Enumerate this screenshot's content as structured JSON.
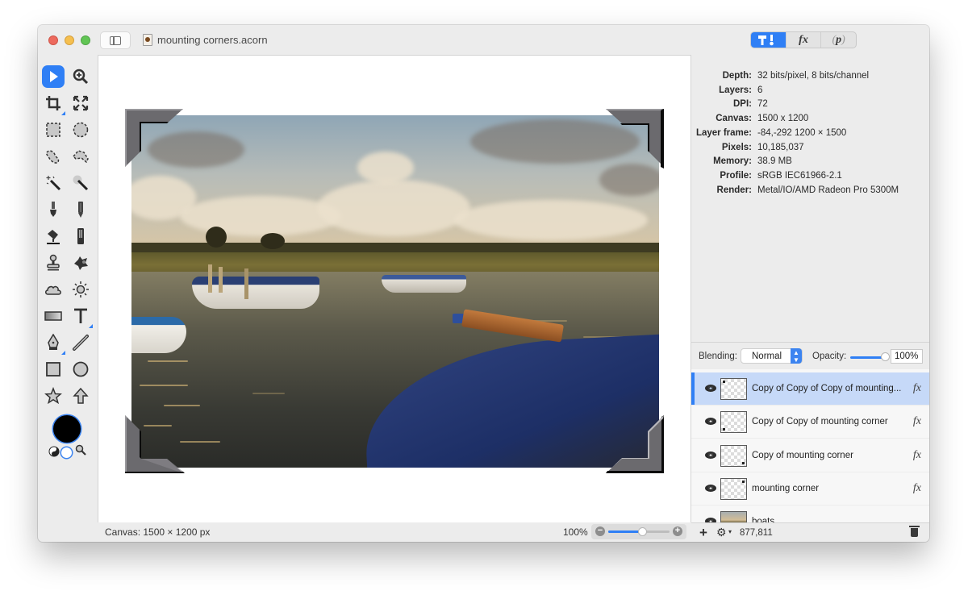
{
  "window": {
    "title": "mounting corners.acorn"
  },
  "inspector_tabs": [
    {
      "name": "tools",
      "icon": "hammer-brush-icon",
      "label": "T!",
      "active": true
    },
    {
      "name": "filters",
      "icon": "fx-icon",
      "label": "fx",
      "active": false
    },
    {
      "name": "plugins",
      "icon": "p-icon",
      "label": "p",
      "active": false
    }
  ],
  "toolbox": {
    "tools": [
      {
        "name": "select-tool",
        "active": true
      },
      {
        "name": "zoom-tool"
      },
      {
        "name": "crop-tool"
      },
      {
        "name": "transform-tool"
      },
      {
        "name": "rect-marquee-tool"
      },
      {
        "name": "ellipse-marquee-tool"
      },
      {
        "name": "lasso-tool"
      },
      {
        "name": "polygon-lasso-tool"
      },
      {
        "name": "magic-wand-tool"
      },
      {
        "name": "instant-alpha-tool"
      },
      {
        "name": "brush-tool"
      },
      {
        "name": "pencil-tool"
      },
      {
        "name": "paint-bucket-tool"
      },
      {
        "name": "eraser-tool"
      },
      {
        "name": "clone-stamp-tool"
      },
      {
        "name": "smudge-tool"
      },
      {
        "name": "cloud-tool"
      },
      {
        "name": "sun-tool"
      },
      {
        "name": "gradient-tool"
      },
      {
        "name": "text-tool"
      },
      {
        "name": "pen-tool"
      },
      {
        "name": "line-tool"
      },
      {
        "name": "rectangle-shape-tool"
      },
      {
        "name": "oval-shape-tool"
      },
      {
        "name": "star-shape-tool"
      },
      {
        "name": "arrow-shape-tool"
      }
    ],
    "foreground_color": "#000000"
  },
  "info": [
    {
      "label": "Depth:",
      "value": "32 bits/pixel, 8 bits/channel"
    },
    {
      "label": "Layers:",
      "value": "6"
    },
    {
      "label": "DPI:",
      "value": "72"
    },
    {
      "label": "Canvas:",
      "value": "1500 x 1200"
    },
    {
      "label": "Layer frame:",
      "value": "-84,-292 1200 × 1500"
    },
    {
      "label": "Pixels:",
      "value": "10,185,037"
    },
    {
      "label": "Memory:",
      "value": "38.9 MB"
    },
    {
      "label": "Profile:",
      "value": "sRGB IEC61966-2.1"
    },
    {
      "label": "Render:",
      "value": "Metal/IO/AMD Radeon Pro 5300M"
    }
  ],
  "blending": {
    "label": "Blending:",
    "mode": "Normal",
    "opacity_label": "Opacity:",
    "opacity_value": "100%",
    "opacity_fraction": 1.0
  },
  "layers": [
    {
      "name": "Copy of Copy of Copy of mounting...",
      "selected": true,
      "visible": true,
      "fx": "fx",
      "thumb": "corner-top-left"
    },
    {
      "name": "Copy of Copy of mounting corner",
      "selected": false,
      "visible": true,
      "fx": "fx",
      "thumb": "corner-bottom-left"
    },
    {
      "name": "Copy of mounting corner",
      "selected": false,
      "visible": true,
      "fx": "fx",
      "thumb": "corner-bottom-right"
    },
    {
      "name": "mounting corner",
      "selected": false,
      "visible": true,
      "fx": "fx",
      "thumb": "corner-top-right"
    },
    {
      "name": "boats",
      "selected": false,
      "visible": true,
      "fx": "",
      "thumb": "photo"
    }
  ],
  "layer_footer": {
    "add": "+",
    "gear": "⚙",
    "caret": "▾",
    "pixel_count": "877,811"
  },
  "status": {
    "canvas": "Canvas: 1500 × 1200 px",
    "zoom": "100%",
    "zoom_slider_fraction": 0.55
  },
  "colors": {
    "accent": "#2f7ff5",
    "selection": "#c6d9f8",
    "corner_gray": "#6b6a6e"
  }
}
